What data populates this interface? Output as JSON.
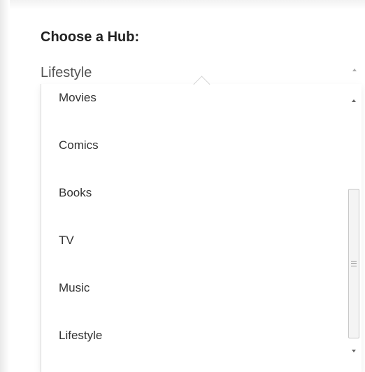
{
  "form": {
    "heading": "Choose a Hub:"
  },
  "select": {
    "selected_value": "Lifestyle",
    "open": true
  },
  "dropdown": {
    "options": [
      {
        "label": "Movies"
      },
      {
        "label": "Comics"
      },
      {
        "label": "Books"
      },
      {
        "label": "TV"
      },
      {
        "label": "Music"
      },
      {
        "label": "Lifestyle"
      }
    ]
  },
  "icons": {
    "select_arrow": "triangle-up-icon",
    "scroll_up": "scroll-up-arrow-icon",
    "scroll_down": "scroll-down-arrow-icon",
    "scroll_grip": "grip-lines-icon"
  }
}
